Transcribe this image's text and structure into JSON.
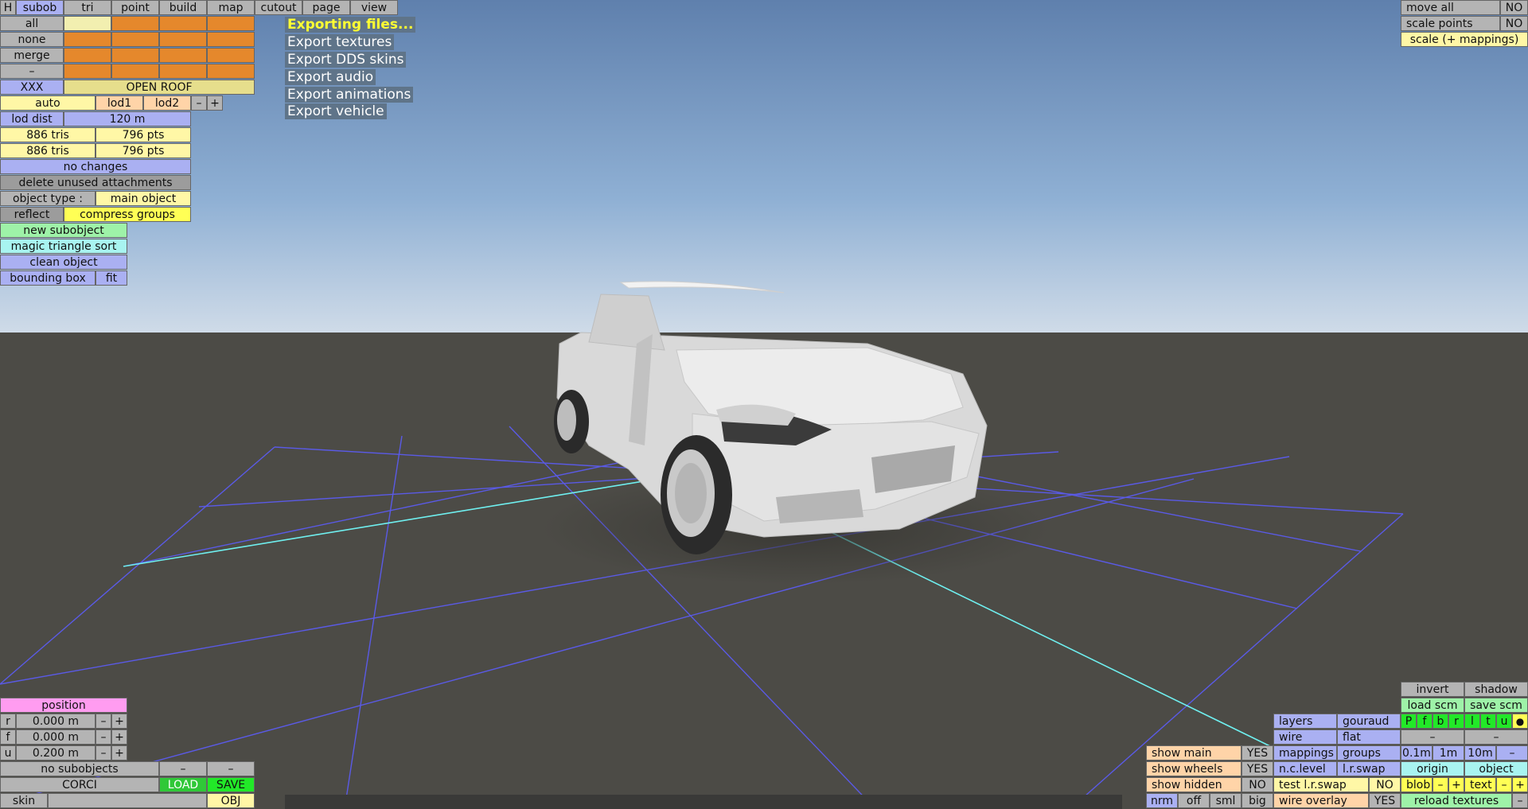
{
  "top_menu": [
    "H",
    "subob",
    "tri",
    "point",
    "build",
    "map",
    "cutout",
    "page",
    "view"
  ],
  "left_panel": {
    "select_all": "all",
    "select_none": "none",
    "merge": "merge",
    "minus": "–",
    "xxx": "XXX",
    "group_name": "OPEN ROOF",
    "auto": "auto",
    "lod1": "lod1",
    "lod2": "lod2",
    "lod_minus": "–",
    "lod_plus": "+",
    "lod_dist_label": "lod dist",
    "lod_dist_value": "120 m",
    "tris_1": "886 tris",
    "pts_1": "796 pts",
    "tris_2": "886 tris",
    "pts_2": "796 pts",
    "no_changes": "no changes",
    "delete_unused": "delete unused attachments",
    "object_type_label": "object type :",
    "object_type_value": "main object",
    "reflect": "reflect",
    "compress_groups": "compress groups",
    "new_subobject": "new subobject",
    "magic_sort": "magic triangle sort",
    "clean_object": "clean object",
    "bounding_box": "bounding box",
    "fit": "fit"
  },
  "export_menu": {
    "items": [
      "Exporting files...",
      "Export textures",
      "Export DDS skins",
      "Export audio",
      "Export animations",
      "Export vehicle"
    ]
  },
  "top_right": {
    "move_all": "move all",
    "move_all_val": "NO",
    "scale_points": "scale points",
    "scale_points_val": "NO",
    "scale_mappings": "scale (+ mappings)"
  },
  "position": {
    "title": "position",
    "rows": [
      {
        "axis": "r",
        "value": "0.000 m",
        "minus": "–",
        "plus": "+"
      },
      {
        "axis": "f",
        "value": "0.000 m",
        "minus": "–",
        "plus": "+"
      },
      {
        "axis": "u",
        "value": "0.200 m",
        "minus": "–",
        "plus": "+"
      }
    ]
  },
  "bottom_left": {
    "no_subobjects": "no subobjects",
    "dash1": "–",
    "dash2": "–",
    "name": "CORCI",
    "load": "LOAD",
    "save": "SAVE",
    "skin": "skin",
    "obj": "OBJ"
  },
  "bottom_right": {
    "invert": "invert",
    "shadow": "shadow",
    "load_scm": "load scm",
    "save_scm": "save scm",
    "layers": "layers",
    "gouraud": "gouraud",
    "layer_buttons": [
      "P",
      "f",
      "b",
      "r",
      "l",
      "t",
      "u",
      "●"
    ],
    "wire": "wire",
    "flat": "flat",
    "dash_a": "–",
    "dash_b": "–",
    "mappings": "mappings",
    "groups": "groups",
    "s01": "0.1m",
    "s1": "1m",
    "s10": "10m",
    "sminus": "–",
    "nc_level": "n.c.level",
    "lr_swap": "l.r.swap",
    "origin": "origin",
    "object": "object",
    "show_main": "show main",
    "show_main_val": "YES",
    "show_wheels": "show wheels",
    "show_wheels_val": "YES",
    "show_hidden": "show hidden",
    "show_hidden_val": "NO",
    "test_lr_swap": "test l.r.swap",
    "test_lr_swap_val": "NO",
    "blob": "blob",
    "blob_minus": "–",
    "blob_plus": "+",
    "text": "text",
    "text_minus": "–",
    "text_plus": "+",
    "nrm": "nrm",
    "off": "off",
    "sml": "sml",
    "big": "big",
    "wire_overlay": "wire overlay",
    "wire_overlay_val": "YES",
    "reload_textures": "reload textures",
    "rt_minus": "–"
  },
  "colors": {
    "sky_top": "#5f80ad",
    "sky_bottom": "#c4d6e6",
    "ground": "#4c4b46",
    "grid": "#5a5ae6",
    "grid_axis": "#6ff0f0",
    "car_body": "#e4e4e4"
  }
}
